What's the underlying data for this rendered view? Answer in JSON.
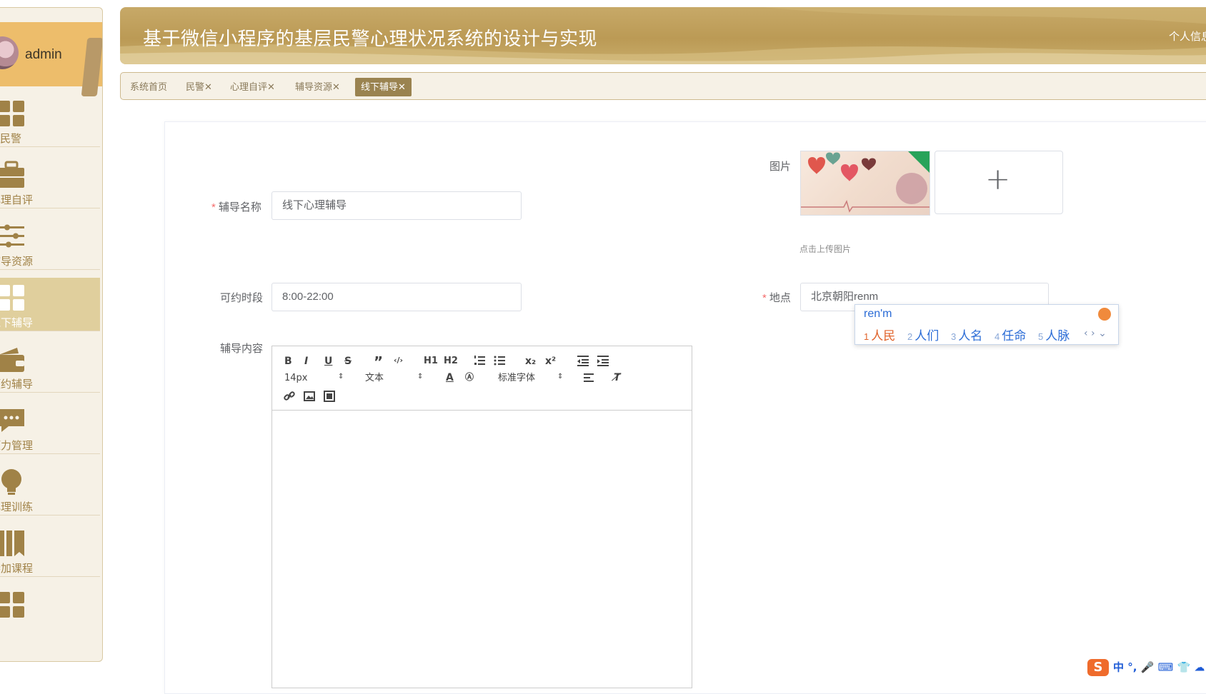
{
  "colors": {
    "accent": "#c2a55f",
    "active_tab": "#9a8350",
    "sidebar_bg": "#f6f1e6",
    "required": "#f56c6c",
    "ime_blue": "#2b6cd6"
  },
  "sidebar": {
    "username": "admin",
    "items": [
      {
        "label": "民警",
        "icon": "grid-icon",
        "active": false
      },
      {
        "label": "心理自评",
        "icon": "briefcase-icon",
        "active": false
      },
      {
        "label": "辅导资源",
        "icon": "sliders-icon",
        "active": false
      },
      {
        "label": "线下辅导",
        "icon": "grid-icon",
        "active": true
      },
      {
        "label": "预约辅导",
        "icon": "wallet-icon",
        "active": false
      },
      {
        "label": "压力管理",
        "icon": "chat-icon",
        "active": false
      },
      {
        "label": "心理训练",
        "icon": "bulb-icon",
        "active": false
      },
      {
        "label": "参加课程",
        "icon": "book-icon",
        "active": false
      },
      {
        "label": "",
        "icon": "grid-icon",
        "active": false
      }
    ]
  },
  "header": {
    "title": "基于微信小程序的基层民警心理状况系统的设计与实现",
    "right_text": "个人信息"
  },
  "tabs": [
    {
      "label": "系统首页",
      "closable": false
    },
    {
      "label": "民警",
      "closable": true
    },
    {
      "label": "心理自评",
      "closable": true
    },
    {
      "label": "辅导资源",
      "closable": true
    },
    {
      "label": "线下辅导",
      "closable": true,
      "active": true
    }
  ],
  "tab_close": "✕",
  "form": {
    "name_label": "辅导名称",
    "name_value": "线下心理辅导",
    "image_label": "图片",
    "upload_hint": "点击上传图片",
    "upload_plus": "+",
    "time_label": "可约时段",
    "time_value": "8:00-22:00",
    "location_label": "地点",
    "location_value": "北京朝阳renm",
    "content_label": "辅导内容",
    "required_mark": "*"
  },
  "editor": {
    "font_size": "14px",
    "text_type": "文本",
    "font_family": "标准字体",
    "buttons": [
      "B",
      "I",
      "U",
      "S",
      "”",
      "‹/›",
      "H1",
      "H2",
      "x₂",
      "x²"
    ]
  },
  "ime": {
    "composition": "ren'm",
    "candidates": [
      {
        "num": "1",
        "text": "人民"
      },
      {
        "num": "2",
        "text": "人们"
      },
      {
        "num": "3",
        "text": "人名"
      },
      {
        "num": "4",
        "text": "任命"
      },
      {
        "num": "5",
        "text": "人脉"
      }
    ],
    "nav": "‹ › ⌄"
  },
  "taskbar_ime": {
    "logo": "S",
    "mode": "中",
    "punct": "°,",
    "extra": "🎤 ⌨ 👕 ☁"
  }
}
